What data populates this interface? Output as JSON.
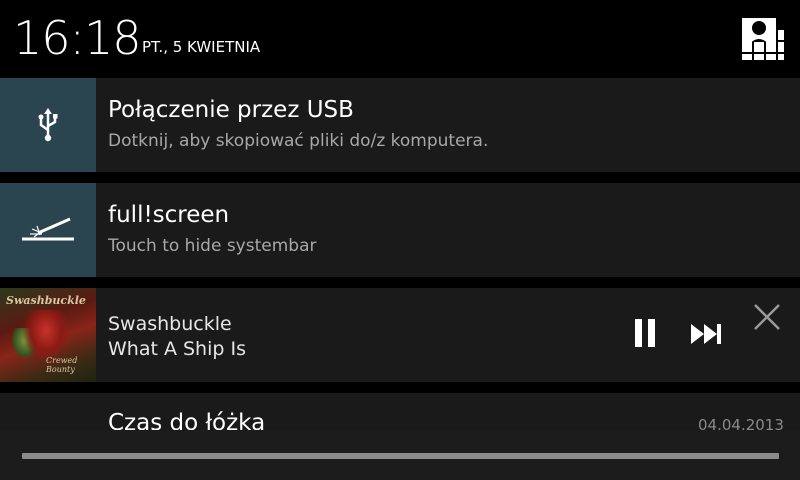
{
  "header": {
    "time": "16:18",
    "date": "PT., 5 KWIETNIA",
    "quick_settings_icon": "user-grid-icon"
  },
  "notifications": [
    {
      "icon": "usb-icon",
      "title": "Połączenie przez USB",
      "text": "Dotknij, aby skopiować pliki do/z komputera."
    },
    {
      "icon": "fullscreen-icon",
      "title": "full!screen",
      "text": "Touch to hide systembar"
    },
    {
      "icon": "album-art",
      "album_text": "Swashbuckle",
      "album_caption": "Crewed Bounty",
      "artist": "Swashbuckle",
      "track": "What A Ship Is",
      "controls": [
        "pause-icon",
        "next-track-icon",
        "close-icon"
      ]
    },
    {
      "title": "Czas do łóżka",
      "timestamp": "04.04.2013"
    }
  ],
  "colors": {
    "icon_background": "#2a4450",
    "notification_background": "#1a1a1a",
    "secondary_text": "#a8a8a8"
  }
}
